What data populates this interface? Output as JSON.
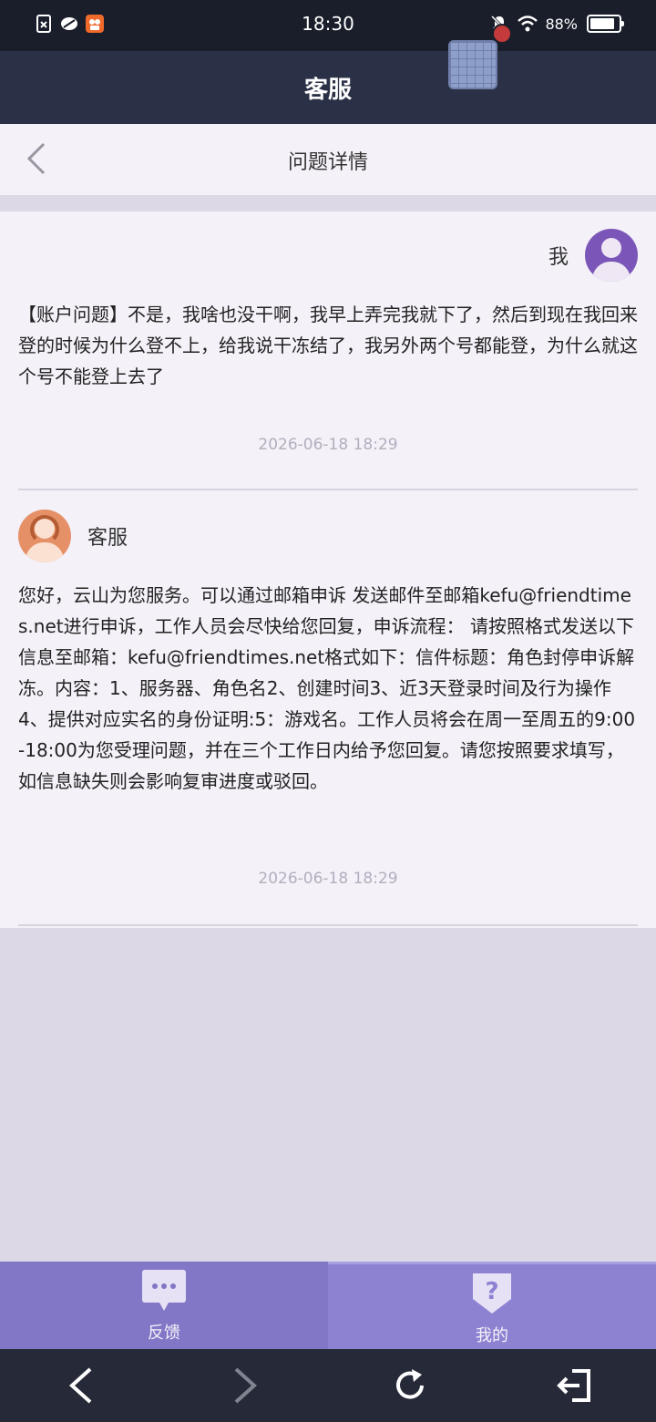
{
  "status_bar": {
    "time": "18:30",
    "battery": "88%",
    "battery_level": 0.88
  },
  "header": {
    "title": "客服"
  },
  "sub_header": {
    "title": "问题详情"
  },
  "messages": [
    {
      "sender": "我",
      "avatar": "user-avatar",
      "text": "【账户问题】不是，我啥也没干啊，我早上弄完我就下了，然后到现在我回来登的时候为什么登不上，给我说干冻结了，我另外两个号都能登，为什么就这个号不能登上去了",
      "timestamp": "2026-06-18 18:29"
    },
    {
      "sender": "客服",
      "avatar": "agent-avatar",
      "text": "您好，云山为您服务。可以通过邮箱申诉 发送邮件至邮箱kefu@friendtimes.net进行申诉，工作人员会尽快给您回复，申诉流程： 请按照格式发送以下信息至邮箱：kefu@friendtimes.net格式如下：信件标题：角色封停申诉解冻。内容：1、服务器、角色名2、创建时间3、近3天登录时间及行为操作4、提供对应实名的身份证明:5：游戏名。工作人员将会在周一至周五的9:00-18:00为您受理问题，并在三个工作日内给予您回复。请您按照要求填写，如信息缺失则会影响复审进度或驳回。",
      "timestamp": "2026-06-18 18:29"
    }
  ],
  "tabs": [
    {
      "label": "反馈",
      "icon": "chat-bubble-icon"
    },
    {
      "label": "我的",
      "icon": "question-icon"
    }
  ],
  "nav": {
    "back": "back-arrow-icon",
    "forward": "forward-arrow-icon",
    "refresh": "refresh-icon",
    "exit": "exit-icon"
  },
  "colors": {
    "header_bg": "#2a3146",
    "page_bg": "#f4f1f8",
    "tab_bg": "#8276c7",
    "tab_active_bg": "#8d82d2",
    "nav_bg": "#262a38"
  }
}
